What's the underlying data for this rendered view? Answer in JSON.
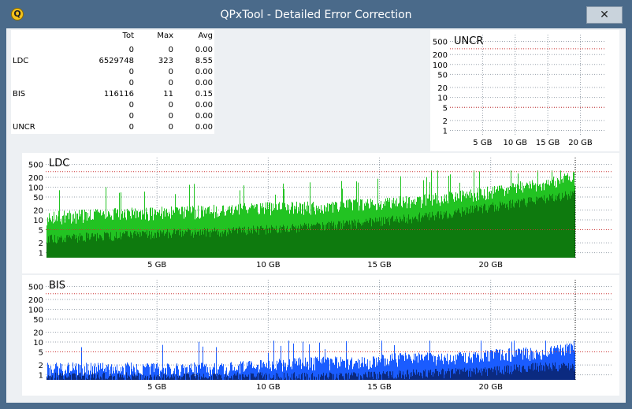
{
  "window": {
    "title": "QPxTool - Detailed Error Correction",
    "close_symbol": "✕"
  },
  "stats": {
    "columns": [
      "Tot",
      "Max",
      "Avg"
    ],
    "rows": [
      {
        "name": "",
        "tot": "0",
        "max": "0",
        "avg": "0.00"
      },
      {
        "name": "LDC",
        "tot": "6529748",
        "max": "323",
        "avg": "8.55"
      },
      {
        "name": "",
        "tot": "0",
        "max": "0",
        "avg": "0.00"
      },
      {
        "name": "",
        "tot": "0",
        "max": "0",
        "avg": "0.00"
      },
      {
        "name": "BIS",
        "tot": "116116",
        "max": "11",
        "avg": "0.15"
      },
      {
        "name": "",
        "tot": "0",
        "max": "0",
        "avg": "0.00"
      },
      {
        "name": "",
        "tot": "0",
        "max": "0",
        "avg": "0.00"
      },
      {
        "name": "UNCR",
        "tot": "0",
        "max": "0",
        "avg": "0.00"
      }
    ]
  },
  "chart_data": [
    {
      "type": "bar",
      "title": "UNCR",
      "y_scale": "log",
      "y_ticks": [
        "500",
        "200",
        "100",
        "50",
        "20",
        "10",
        "5",
        "2",
        "1"
      ],
      "x_ticks": [
        "5 GB",
        "10 GB",
        "15 GB",
        "20 GB"
      ],
      "xlim": [
        0,
        23.8
      ],
      "threshold_lines": [
        5,
        300
      ],
      "series": [],
      "colors": {
        "threshold": "#cc3333",
        "grid": "#9aa3ad"
      }
    },
    {
      "type": "bar",
      "title": "LDC",
      "y_scale": "log",
      "y_ticks": [
        "500",
        "200",
        "100",
        "50",
        "20",
        "10",
        "5",
        "2",
        "1"
      ],
      "x_ticks": [
        "5 GB",
        "10 GB",
        "15 GB",
        "20 GB"
      ],
      "xlim": [
        0,
        25.5
      ],
      "data_end_gb": 23.8,
      "threshold_lines": [
        5,
        300
      ],
      "max_value": 323,
      "average": 8.55,
      "envelope_gb": [
        0,
        2,
        4,
        6,
        8,
        10,
        12,
        14,
        16,
        18,
        20,
        22,
        23.8
      ],
      "envelope_max": [
        15,
        18,
        20,
        22,
        25,
        30,
        32,
        38,
        45,
        60,
        90,
        150,
        250
      ],
      "envelope_avg": [
        3,
        3.5,
        4,
        4.5,
        5,
        6,
        7,
        9,
        12,
        18,
        28,
        45,
        70
      ],
      "colors": {
        "max": "#22c322",
        "avg": "#0e7a0e",
        "threshold": "#cc3333",
        "grid": "#9aa3ad"
      }
    },
    {
      "type": "bar",
      "title": "BIS",
      "y_scale": "log",
      "y_ticks": [
        "500",
        "200",
        "100",
        "50",
        "20",
        "10",
        "5",
        "2",
        "1"
      ],
      "x_ticks": [
        "5 GB",
        "10 GB",
        "15 GB",
        "20 GB"
      ],
      "xlim": [
        0,
        25.5
      ],
      "data_end_gb": 23.8,
      "threshold_lines": [
        5,
        300
      ],
      "max_value": 11,
      "average": 0.15,
      "envelope_gb": [
        0,
        4,
        8,
        12,
        14,
        16,
        18,
        20,
        22,
        23.8
      ],
      "envelope_max": [
        2,
        2,
        2,
        3,
        3,
        4,
        4,
        5,
        6,
        8
      ],
      "envelope_avg": [
        1,
        1,
        1,
        1,
        1,
        1.2,
        1.3,
        1.5,
        2,
        2.2
      ],
      "colors": {
        "max": "#1a5cff",
        "avg": "#0b2a80",
        "threshold": "#cc3333",
        "grid": "#9aa3ad"
      }
    }
  ]
}
